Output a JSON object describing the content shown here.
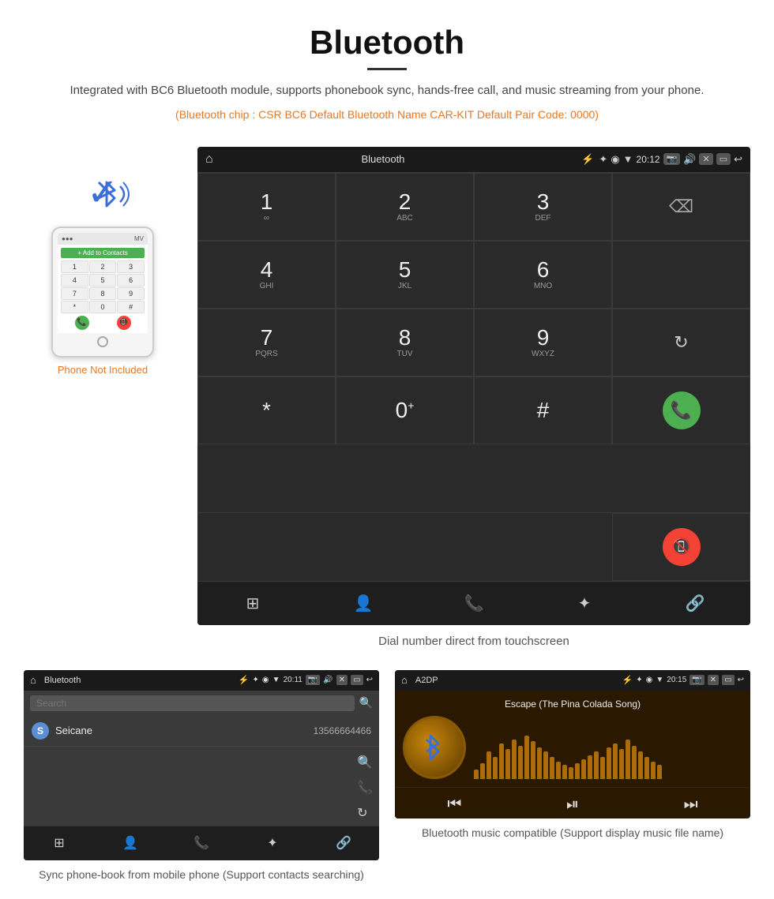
{
  "header": {
    "title": "Bluetooth",
    "description": "Integrated with BC6 Bluetooth module, supports phonebook sync, hands-free call, and music streaming from your phone.",
    "specs": "(Bluetooth chip : CSR BC6    Default Bluetooth Name CAR-KIT    Default Pair Code: 0000)"
  },
  "phone_side": {
    "not_included_label": "Phone Not Included",
    "keypad_keys": [
      "1",
      "2",
      "3",
      "4",
      "5",
      "6",
      "7",
      "8",
      "9",
      "*",
      "0",
      "#"
    ],
    "add_contacts_label": "+ Add to Contacts"
  },
  "dial_screen": {
    "title": "Bluetooth",
    "time": "20:12",
    "keys": [
      {
        "num": "1",
        "letters": "∞"
      },
      {
        "num": "2",
        "letters": "ABC"
      },
      {
        "num": "3",
        "letters": "DEF"
      },
      {
        "num": "4",
        "letters": "GHI"
      },
      {
        "num": "5",
        "letters": "JKL"
      },
      {
        "num": "6",
        "letters": "MNO"
      },
      {
        "num": "7",
        "letters": "PQRS"
      },
      {
        "num": "8",
        "letters": "TUV"
      },
      {
        "num": "9",
        "letters": "WXYZ"
      },
      {
        "num": "*",
        "letters": ""
      },
      {
        "num": "0",
        "letters": "+"
      },
      {
        "num": "#",
        "letters": ""
      }
    ],
    "caption": "Dial number direct from touchscreen"
  },
  "phonebook_screen": {
    "title": "Bluetooth",
    "time": "20:11",
    "search_placeholder": "Search",
    "contacts": [
      {
        "letter": "S",
        "name": "Seicane",
        "phone": "13566664466"
      }
    ],
    "caption": "Sync phone-book from mobile phone\n(Support contacts searching)"
  },
  "music_screen": {
    "title": "A2DP",
    "time": "20:15",
    "song_title": "Escape (The Pina Colada Song)",
    "bluetooth_symbol": "♦",
    "caption": "Bluetooth music compatible\n(Support display music file name)"
  },
  "visualizer_bars": [
    12,
    20,
    35,
    28,
    45,
    38,
    50,
    42,
    55,
    48,
    40,
    35,
    28,
    22,
    18,
    15,
    20,
    25,
    30,
    35,
    28,
    40,
    45,
    38,
    50,
    42,
    35,
    28,
    22,
    18
  ]
}
